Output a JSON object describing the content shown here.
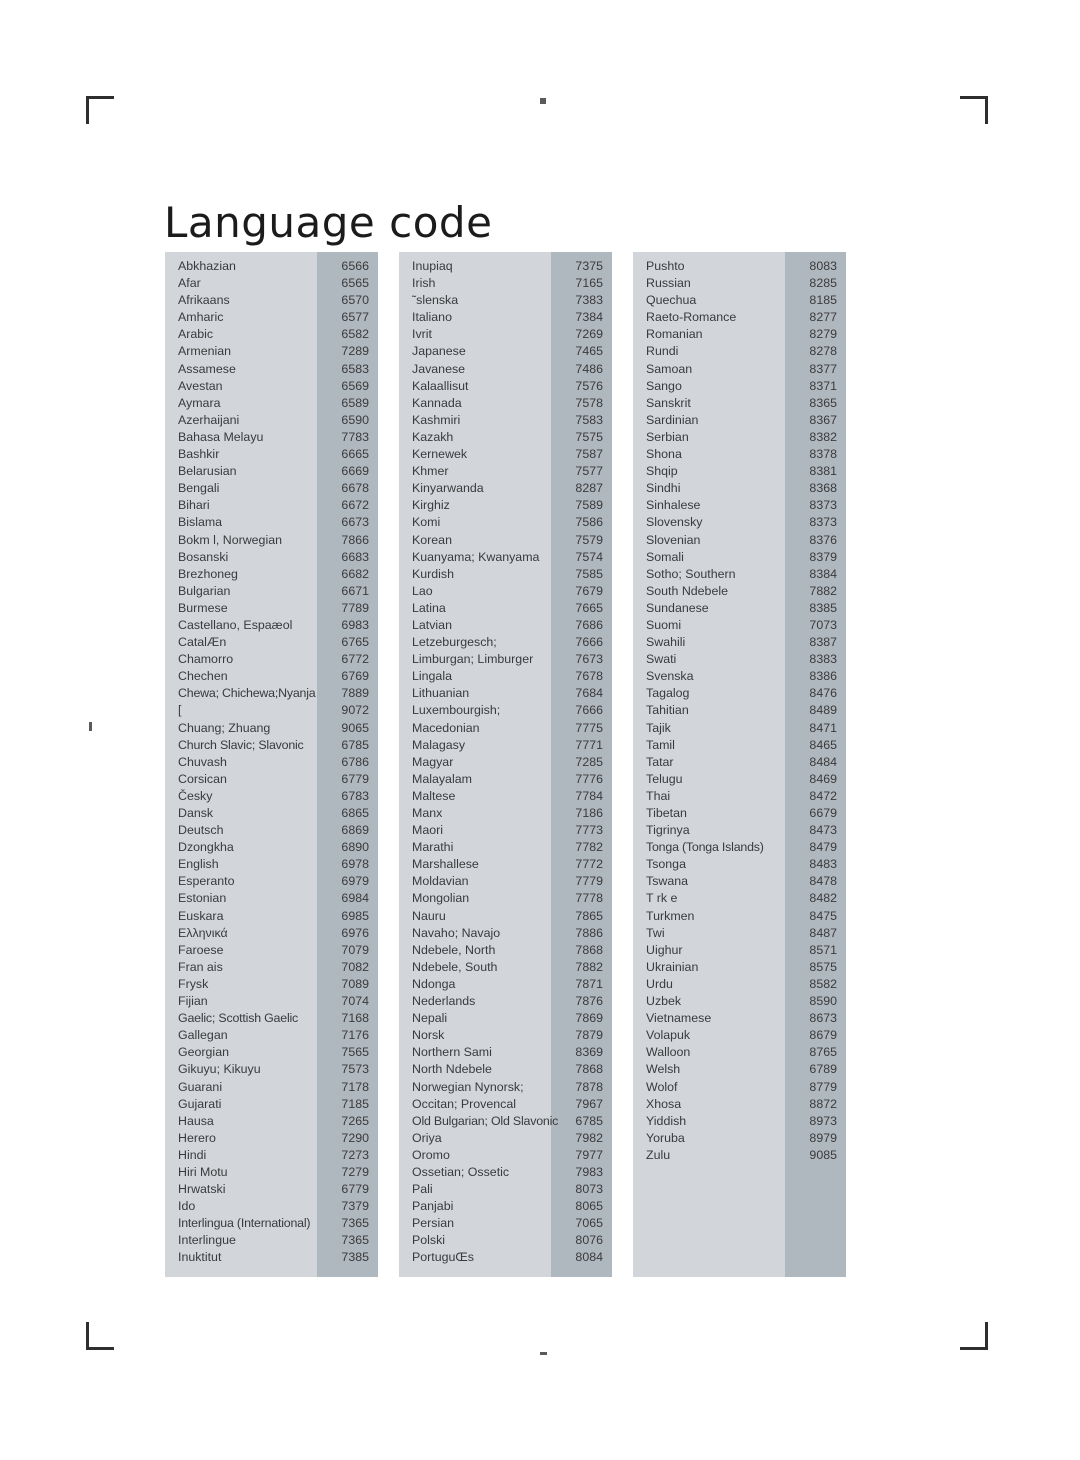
{
  "page": {
    "title": "Language code",
    "marks": {
      "crop_top_left": "crop-mark",
      "crop_top_right": "crop-mark",
      "crop_bottom_left": "crop-mark",
      "crop_bottom_right": "crop-mark",
      "registration_top": "registration-mark",
      "registration_bottom": "registration-mark",
      "registration_left": "registration-mark"
    },
    "colors": {
      "page_background": "#ffffff",
      "table_name_background": "#d2d6da",
      "table_code_background": "#b0b8bf",
      "text": "#3a3a3c",
      "title_text": "#1b1b1b",
      "crop_mark": "#2e2e2e"
    }
  },
  "table": {
    "columns": [
      {
        "id": "column-1",
        "rows": [
          {
            "language": "Abkhazian",
            "code": "6566"
          },
          {
            "language": "Afar",
            "code": "6565"
          },
          {
            "language": "Afrikaans",
            "code": "6570"
          },
          {
            "language": "Amharic",
            "code": "6577"
          },
          {
            "language": "Arabic",
            "code": "6582"
          },
          {
            "language": "Armenian",
            "code": "7289"
          },
          {
            "language": "Assamese",
            "code": "6583"
          },
          {
            "language": "Avestan",
            "code": "6569"
          },
          {
            "language": "Aymara",
            "code": "6589"
          },
          {
            "language": "Azerhaijani",
            "code": "6590"
          },
          {
            "language": "Bahasa Melayu",
            "code": "7783"
          },
          {
            "language": "Bashkir",
            "code": "6665"
          },
          {
            "language": "Belarusian",
            "code": "6669"
          },
          {
            "language": "Bengali",
            "code": "6678"
          },
          {
            "language": "Bihari",
            "code": "6672"
          },
          {
            "language": "Bislama",
            "code": "6673"
          },
          {
            "language": "Bokm l, Norwegian",
            "code": "7866"
          },
          {
            "language": "Bosanski",
            "code": "6683"
          },
          {
            "language": "Brezhoneg",
            "code": "6682"
          },
          {
            "language": "Bulgarian",
            "code": "6671"
          },
          {
            "language": "Burmese",
            "code": "7789"
          },
          {
            "language": "Castellano, Espaæol",
            "code": "6983"
          },
          {
            "language": "CatalÆn",
            "code": "6765"
          },
          {
            "language": "Chamorro",
            "code": "6772"
          },
          {
            "language": "Chechen",
            "code": "6769"
          },
          {
            "language": "Chewa; Chichewa;Nyanja",
            "code": "7889"
          },
          {
            "language": "[",
            "code": "9072"
          },
          {
            "language": "Chuang; Zhuang",
            "code": "9065"
          },
          {
            "language": "Church Slavic; Slavonic",
            "code": "6785"
          },
          {
            "language": "Chuvash",
            "code": "6786"
          },
          {
            "language": "Corsican",
            "code": "6779"
          },
          {
            "language": "Česky",
            "code": "6783"
          },
          {
            "language": "Dansk",
            "code": "6865"
          },
          {
            "language": "Deutsch",
            "code": "6869"
          },
          {
            "language": "Dzongkha",
            "code": "6890"
          },
          {
            "language": "English",
            "code": "6978"
          },
          {
            "language": "Esperanto",
            "code": "6979"
          },
          {
            "language": "Estonian",
            "code": "6984"
          },
          {
            "language": "Euskara",
            "code": "6985"
          },
          {
            "language": "Ελληνικά",
            "code": "6976"
          },
          {
            "language": "Faroese",
            "code": "7079"
          },
          {
            "language": "Fran ais",
            "code": "7082"
          },
          {
            "language": "Frysk",
            "code": "7089"
          },
          {
            "language": "Fijian",
            "code": "7074"
          },
          {
            "language": "Gaelic; Scottish Gaelic",
            "code": "7168"
          },
          {
            "language": "Gallegan",
            "code": "7176"
          },
          {
            "language": "Georgian",
            "code": "7565"
          },
          {
            "language": "Gikuyu; Kikuyu",
            "code": "7573"
          },
          {
            "language": "Guarani",
            "code": "7178"
          },
          {
            "language": "Gujarati",
            "code": "7185"
          },
          {
            "language": "Hausa",
            "code": "7265"
          },
          {
            "language": "Herero",
            "code": "7290"
          },
          {
            "language": "Hindi",
            "code": "7273"
          },
          {
            "language": "Hiri Motu",
            "code": "7279"
          },
          {
            "language": "Hrwatski",
            "code": "6779"
          },
          {
            "language": "Ido",
            "code": "7379"
          },
          {
            "language": "Interlingua (International)",
            "code": "7365"
          },
          {
            "language": "Interlingue",
            "code": "7365"
          },
          {
            "language": "Inuktitut",
            "code": "7385"
          }
        ]
      },
      {
        "id": "column-2",
        "rows": [
          {
            "language": "Inupiaq",
            "code": "7375"
          },
          {
            "language": "Irish",
            "code": "7165"
          },
          {
            "language": "˜slenska",
            "code": "7383"
          },
          {
            "language": "Italiano",
            "code": "7384"
          },
          {
            "language": "Ivrit",
            "code": "7269"
          },
          {
            "language": "Japanese",
            "code": "7465"
          },
          {
            "language": "Javanese",
            "code": "7486"
          },
          {
            "language": "Kalaallisut",
            "code": "7576"
          },
          {
            "language": "Kannada",
            "code": "7578"
          },
          {
            "language": "Kashmiri",
            "code": "7583"
          },
          {
            "language": "Kazakh",
            "code": "7575"
          },
          {
            "language": "Kernewek",
            "code": "7587"
          },
          {
            "language": "Khmer",
            "code": "7577"
          },
          {
            "language": "Kinyarwanda",
            "code": "8287"
          },
          {
            "language": "Kirghiz",
            "code": "7589"
          },
          {
            "language": "Komi",
            "code": "7586"
          },
          {
            "language": "Korean",
            "code": "7579"
          },
          {
            "language": "Kuanyama; Kwanyama",
            "code": "7574"
          },
          {
            "language": "Kurdish",
            "code": "7585"
          },
          {
            "language": "Lao",
            "code": "7679"
          },
          {
            "language": "Latina",
            "code": "7665"
          },
          {
            "language": "Latvian",
            "code": "7686"
          },
          {
            "language": "Letzeburgesch;",
            "code": "7666"
          },
          {
            "language": "Limburgan; Limburger",
            "code": "7673"
          },
          {
            "language": "Lingala",
            "code": "7678"
          },
          {
            "language": "Lithuanian",
            "code": "7684"
          },
          {
            "language": "Luxembourgish;",
            "code": "7666"
          },
          {
            "language": "Macedonian",
            "code": "7775"
          },
          {
            "language": "Malagasy",
            "code": "7771"
          },
          {
            "language": "Magyar",
            "code": "7285"
          },
          {
            "language": "Malayalam",
            "code": "7776"
          },
          {
            "language": "Maltese",
            "code": "7784"
          },
          {
            "language": "Manx",
            "code": "7186"
          },
          {
            "language": "Maori",
            "code": "7773"
          },
          {
            "language": "Marathi",
            "code": "7782"
          },
          {
            "language": "Marshallese",
            "code": "7772"
          },
          {
            "language": "Moldavian",
            "code": "7779"
          },
          {
            "language": "Mongolian",
            "code": "7778"
          },
          {
            "language": "Nauru",
            "code": "7865"
          },
          {
            "language": "Navaho; Navajo",
            "code": "7886"
          },
          {
            "language": "Ndebele, North",
            "code": "7868"
          },
          {
            "language": "Ndebele, South",
            "code": "7882"
          },
          {
            "language": "Ndonga",
            "code": "7871"
          },
          {
            "language": "Nederlands",
            "code": "7876"
          },
          {
            "language": "Nepali",
            "code": "7869"
          },
          {
            "language": "Norsk",
            "code": "7879"
          },
          {
            "language": "Northern Sami",
            "code": "8369"
          },
          {
            "language": "North Ndebele",
            "code": "7868"
          },
          {
            "language": "Norwegian Nynorsk;",
            "code": "7878"
          },
          {
            "language": "Occitan; Provencal",
            "code": "7967"
          },
          {
            "language": "Old Bulgarian; Old Slavonic",
            "code": "6785"
          },
          {
            "language": "Oriya",
            "code": "7982"
          },
          {
            "language": "Oromo",
            "code": "7977"
          },
          {
            "language": "Ossetian; Ossetic",
            "code": "7983"
          },
          {
            "language": "Pali",
            "code": "8073"
          },
          {
            "language": "Panjabi",
            "code": "8065"
          },
          {
            "language": "Persian",
            "code": "7065"
          },
          {
            "language": "Polski",
            "code": "8076"
          },
          {
            "language": "PortuguŒs",
            "code": "8084"
          }
        ]
      },
      {
        "id": "column-3",
        "rows": [
          {
            "language": "Pushto",
            "code": "8083"
          },
          {
            "language": "Russian",
            "code": "8285"
          },
          {
            "language": "Quechua",
            "code": "8185"
          },
          {
            "language": "Raeto-Romance",
            "code": "8277"
          },
          {
            "language": "Romanian",
            "code": "8279"
          },
          {
            "language": "Rundi",
            "code": "8278"
          },
          {
            "language": "Samoan",
            "code": "8377"
          },
          {
            "language": "Sango",
            "code": "8371"
          },
          {
            "language": "Sanskrit",
            "code": "8365"
          },
          {
            "language": "Sardinian",
            "code": "8367"
          },
          {
            "language": "Serbian",
            "code": "8382"
          },
          {
            "language": "Shona",
            "code": "8378"
          },
          {
            "language": "Shqip",
            "code": "8381"
          },
          {
            "language": "Sindhi",
            "code": "8368"
          },
          {
            "language": "Sinhalese",
            "code": "8373"
          },
          {
            "language": "Slovensky",
            "code": "8373"
          },
          {
            "language": "Slovenian",
            "code": "8376"
          },
          {
            "language": "Somali",
            "code": "8379"
          },
          {
            "language": "Sotho; Southern",
            "code": "8384"
          },
          {
            "language": "South Ndebele",
            "code": "7882"
          },
          {
            "language": "Sundanese",
            "code": "8385"
          },
          {
            "language": "Suomi",
            "code": "7073"
          },
          {
            "language": "Swahili",
            "code": "8387"
          },
          {
            "language": "Swati",
            "code": "8383"
          },
          {
            "language": "Svenska",
            "code": "8386"
          },
          {
            "language": "Tagalog",
            "code": "8476"
          },
          {
            "language": "Tahitian",
            "code": "8489"
          },
          {
            "language": "Tajik",
            "code": "8471"
          },
          {
            "language": "Tamil",
            "code": "8465"
          },
          {
            "language": "Tatar",
            "code": "8484"
          },
          {
            "language": "Telugu",
            "code": "8469"
          },
          {
            "language": "Thai",
            "code": "8472"
          },
          {
            "language": "Tibetan",
            "code": "6679"
          },
          {
            "language": "Tigrinya",
            "code": "8473"
          },
          {
            "language": "Tonga (Tonga Islands)",
            "code": "8479"
          },
          {
            "language": "Tsonga",
            "code": "8483"
          },
          {
            "language": "Tswana",
            "code": "8478"
          },
          {
            "language": "T rk e",
            "code": "8482"
          },
          {
            "language": "Turkmen",
            "code": "8475"
          },
          {
            "language": "Twi",
            "code": "8487"
          },
          {
            "language": "Uighur",
            "code": "8571"
          },
          {
            "language": "Ukrainian",
            "code": "8575"
          },
          {
            "language": "Urdu",
            "code": "8582"
          },
          {
            "language": "Uzbek",
            "code": "8590"
          },
          {
            "language": "Vietnamese",
            "code": "8673"
          },
          {
            "language": "Volapuk",
            "code": "8679"
          },
          {
            "language": "Walloon",
            "code": "8765"
          },
          {
            "language": "Welsh",
            "code": "6789"
          },
          {
            "language": "Wolof",
            "code": "8779"
          },
          {
            "language": "Xhosa",
            "code": "8872"
          },
          {
            "language": "Yiddish",
            "code": "8973"
          },
          {
            "language": "Yoruba",
            "code": "8979"
          },
          {
            "language": "Zulu",
            "code": "9085"
          }
        ]
      }
    ]
  }
}
